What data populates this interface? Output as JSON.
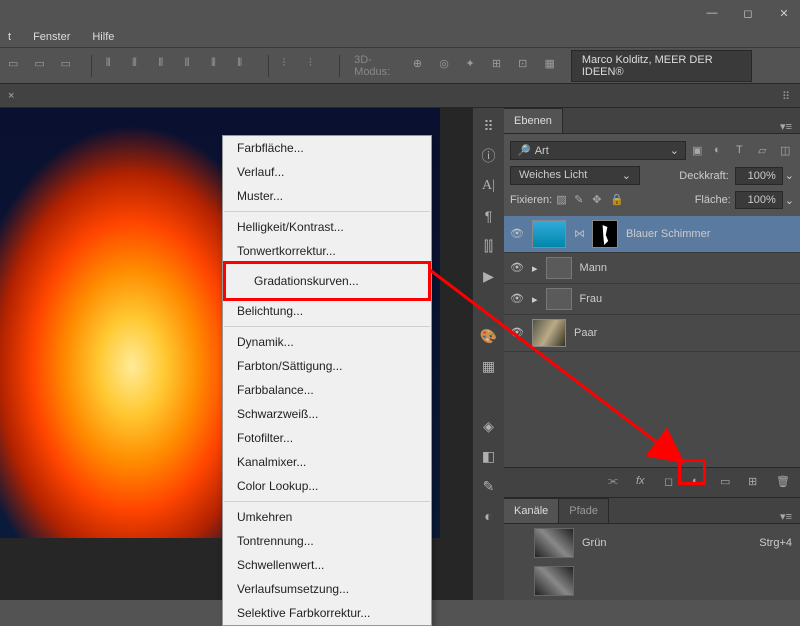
{
  "menu": {
    "fenster": "Fenster",
    "hilfe": "Hilfe"
  },
  "toolbar": {
    "mode": "3D-Modus:",
    "user": "Marco Kolditz, MEER DER IDEEN®"
  },
  "context": {
    "g1": [
      "Farbfläche...",
      "Verlauf...",
      "Muster..."
    ],
    "g2": [
      "Helligkeit/Kontrast...",
      "Tonwertkorrektur...",
      "Gradationskurven...",
      "Belichtung..."
    ],
    "g3": [
      "Dynamik...",
      "Farbton/Sättigung...",
      "Farbbalance...",
      "Schwarzweiß...",
      "Fotofilter...",
      "Kanalmixer...",
      "Color Lookup..."
    ],
    "g4": [
      "Umkehren",
      "Tontrennung...",
      "Schwellenwert...",
      "Verlaufsumsetzung...",
      "Selektive Farbkorrektur..."
    ]
  },
  "panels": {
    "ebenen": "Ebenen",
    "kanaele": "Kanäle",
    "pfade": "Pfade",
    "search": "Art",
    "blend": "Weiches Licht",
    "deckkraft": "Deckkraft:",
    "flaeche": "Fläche:",
    "hundert": "100%",
    "fixieren": "Fixieren:"
  },
  "layers": {
    "l1": "Blauer Schimmer",
    "l2": "Mann",
    "l3": "Frau",
    "l4": "Paar"
  },
  "channel": {
    "name": "Grün",
    "key": "Strg+4"
  }
}
